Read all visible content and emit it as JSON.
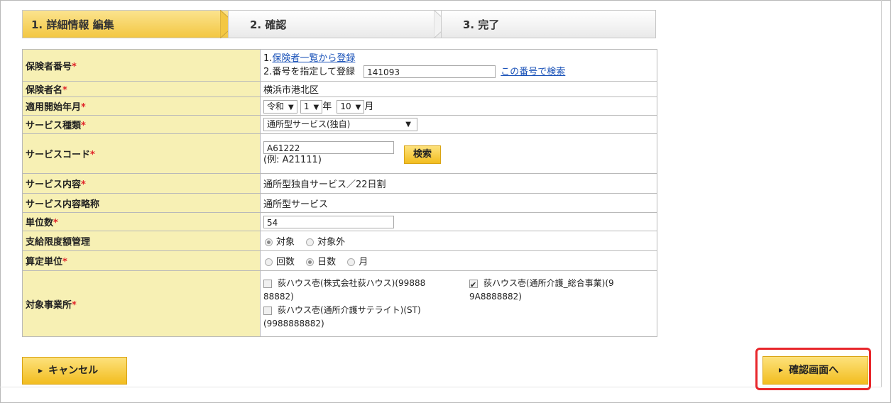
{
  "steps": {
    "step1": "1. 詳細情報 編集",
    "step2": "2. 確認",
    "step3": "3. 完了"
  },
  "required_mark": "*",
  "rows": {
    "insurer_number": {
      "label": "保険者番号",
      "option1_prefix": "1.",
      "option1_link": "保険者一覧から登録",
      "option2_label": "2.番号を指定して登録",
      "option2_value": "141093",
      "option2_link": "この番号で検索"
    },
    "insurer_name": {
      "label": "保険者名",
      "value": "横浜市港北区"
    },
    "start_month": {
      "label": "適用開始年月",
      "era": "令和",
      "year": "1",
      "year_unit": "年",
      "month": "10",
      "month_unit": "月"
    },
    "service_type": {
      "label": "サービス種類",
      "value": "通所型サービス(独自)"
    },
    "service_code": {
      "label": "サービスコード",
      "value": "A61222",
      "search_button": "検索",
      "example": "(例: A21111)"
    },
    "service_content": {
      "label": "サービス内容",
      "value": "通所型独自サービス／22日割"
    },
    "service_abbrev": {
      "label": "サービス内容略称",
      "value": "通所型サービス"
    },
    "units": {
      "label": "単位数",
      "value": "54"
    },
    "limit_mgmt": {
      "label": "支給限度額管理",
      "option_on": "対象",
      "option_off": "対象外"
    },
    "calc_unit": {
      "label": "算定単位",
      "option_times": "回数",
      "option_days": "日数",
      "option_month": "月"
    },
    "target_offices": {
      "label": "対象事業所",
      "office1_line1": "荻ハウス壱(株式会社荻ハウス)(99888",
      "office1_line2": "88882)",
      "office2_line1": "荻ハウス壱(通所介護_総合事業)(9",
      "office2_line2": "9A8888882)",
      "office3_line1": "荻ハウス壱(通所介護サテライト)(ST)",
      "office3_line2": "(9988888882)"
    }
  },
  "buttons": {
    "cancel": "キャンセル",
    "confirm": "確認画面へ"
  },
  "icons": {
    "dropdown": "▼",
    "button_arrow": "▶"
  }
}
